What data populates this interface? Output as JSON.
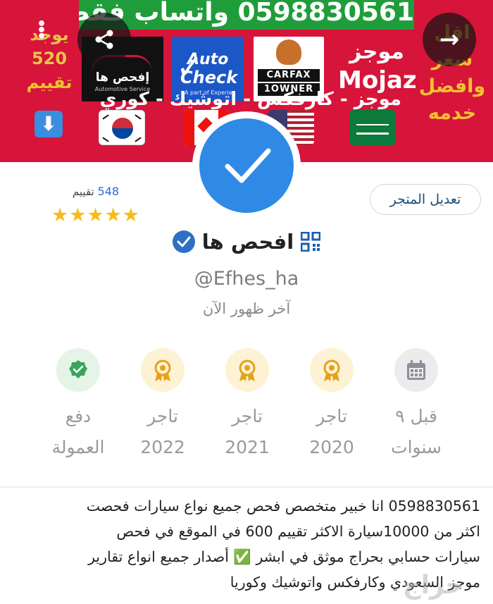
{
  "banner": {
    "phone_strip": "0598830561 واتساب فقط",
    "left_promo": {
      "line1": "يوجد",
      "line2": "520",
      "line3": "تقييم"
    },
    "down_arrow": "⬇",
    "right_promo": {
      "line1": "اقل",
      "line2": "سعر",
      "line3": "وافضل",
      "line4": "خدمه"
    },
    "logos": {
      "afhas_name": "إفحص ها",
      "afhas_sub": "Automotive Service",
      "autocheck_l1": "Auto",
      "autocheck_l2": "Check",
      "autocheck_sub": "A part of Experian",
      "carfax_l1": "CARFAX",
      "carfax_l2": "1OWNER",
      "mojaz_ar": "موجز",
      "mojaz_en": "Mojaz"
    },
    "services_line": "موجز - كارفكس - اتوشيك - كوري",
    "flags": [
      "korea-flag",
      "canada-flag",
      "usa-flag",
      "saudi-flag"
    ]
  },
  "profile": {
    "edit_store_label": "تعديل المتجر",
    "rating_count": "548",
    "rating_word": "تقييم",
    "stars": "★★★★★",
    "store_name": "افحص ها",
    "handle": "@Efhes_ha",
    "last_seen": "آخر ظهور الآن"
  },
  "badges": [
    {
      "icon": "calendar-icon",
      "line1": "قبل ٩",
      "line2": "سنوات",
      "tone": "gray"
    },
    {
      "icon": "medal-icon",
      "line1": "تاجر",
      "line2": "2020",
      "tone": "gold"
    },
    {
      "icon": "medal-icon",
      "line1": "تاجر",
      "line2": "2021",
      "tone": "gold"
    },
    {
      "icon": "medal-icon",
      "line1": "تاجر",
      "line2": "2022",
      "tone": "gold"
    },
    {
      "icon": "verified-commission-icon",
      "line1": "دفع",
      "line2": "العمولة",
      "tone": "green"
    }
  ],
  "description": {
    "line1": "0598830561 انا خبير متخصص فحص جميع نواع سيارات فحصت",
    "line2": "اكثر من 10000سيارة الاكثر تقييم 600 في الموقع في فحص",
    "line3": "سيارات حسابي بحراج موثق في ابشر ✅ أصدار جميع انواع تقارير",
    "line4": "موجز السعودي وكارفكس واتوشيك وكوريا"
  },
  "watermark": "حراج",
  "colors": {
    "banner_red": "#d7143a",
    "phone_green": "#1f9d3a",
    "accent_blue": "#2f8ae5",
    "star_gold": "#f6bd16",
    "muted_text": "#9a9a9a"
  }
}
